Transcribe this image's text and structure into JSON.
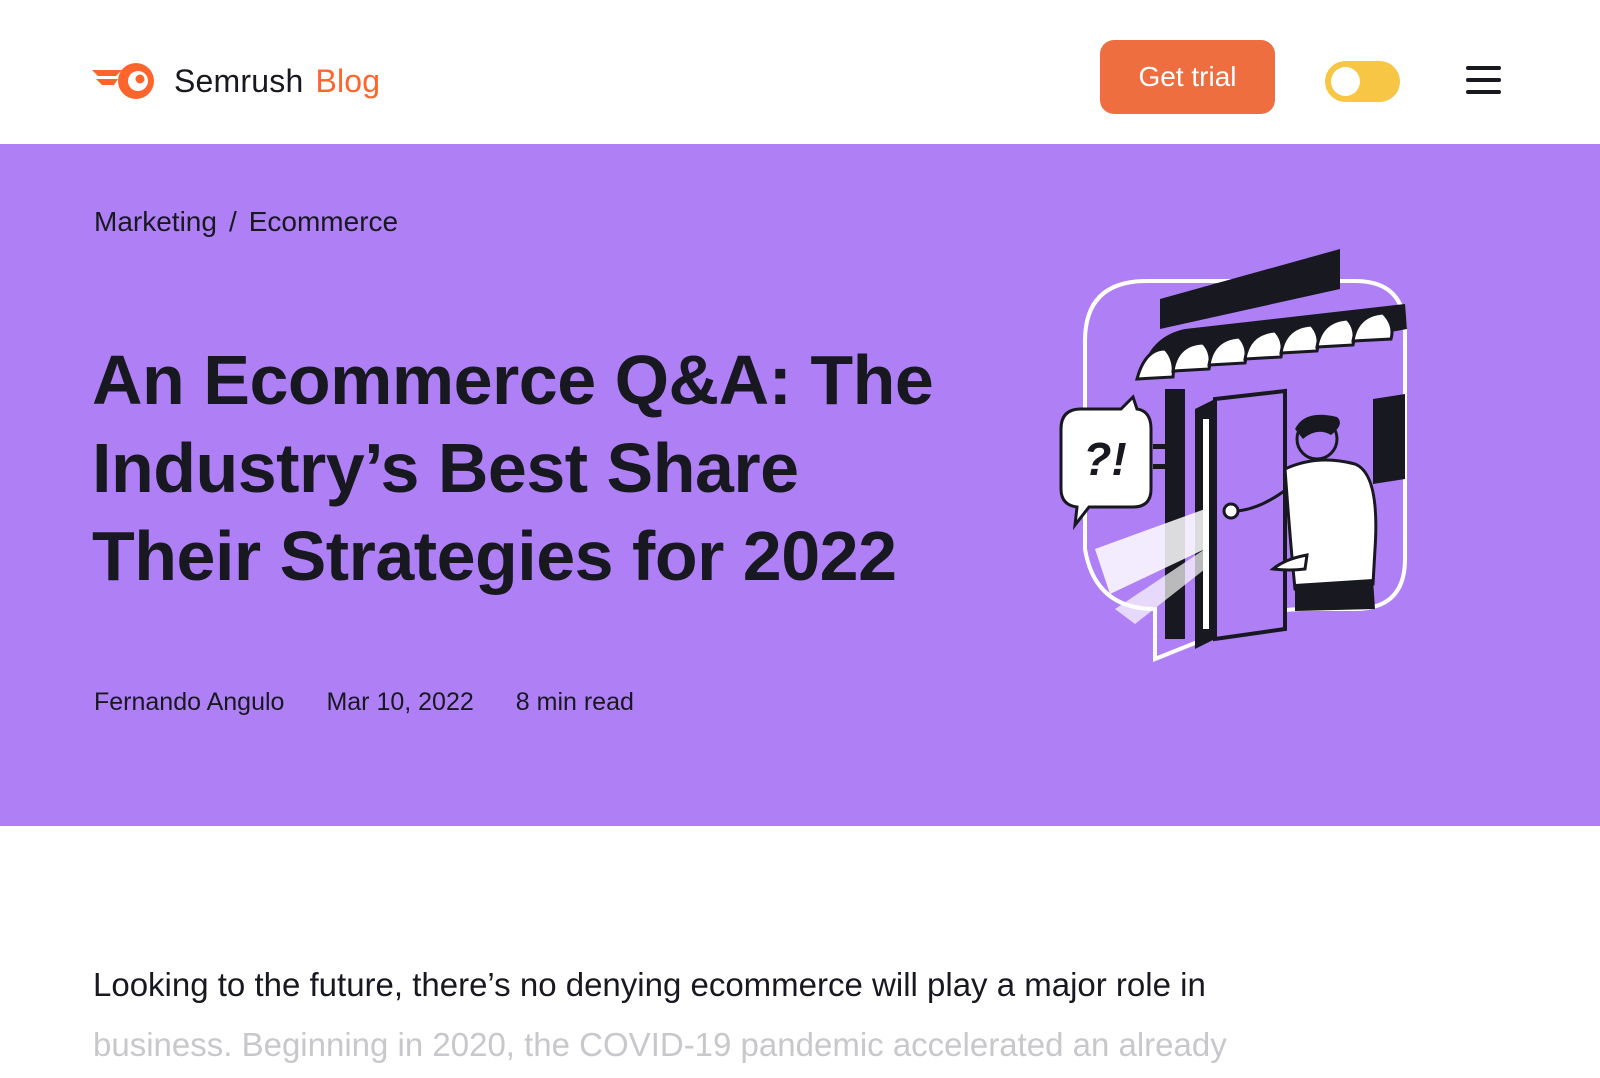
{
  "header": {
    "brand": "Semrush",
    "blog": "Blog",
    "cta_label": "Get trial",
    "logo_icon": "semrush-fireball-icon",
    "toggle_icon": "theme-toggle",
    "menu_icon": "hamburger-menu-icon"
  },
  "hero": {
    "breadcrumb": [
      "Marketing",
      "Ecommerce"
    ],
    "breadcrumb_separator": "/",
    "title": "An Ecommerce Q&A: The Industry’s Best Share Their Strategies for 2022",
    "author": "Fernando Angulo",
    "date": "Mar 10, 2022",
    "read_time": "8 min read",
    "illustration_text": "?!"
  },
  "article": {
    "intro_line1": "Looking to the future, there’s no denying ecommerce will play a major role in",
    "intro_line2": "business. Beginning in 2020, the COVID-19 pandemic accelerated an already"
  },
  "colors": {
    "accent_orange": "#ee6e3f",
    "brand_orange": "#ff642d",
    "hero_purple": "#af80f5",
    "toggle_yellow": "#f6c644",
    "text_dark": "#181821"
  }
}
